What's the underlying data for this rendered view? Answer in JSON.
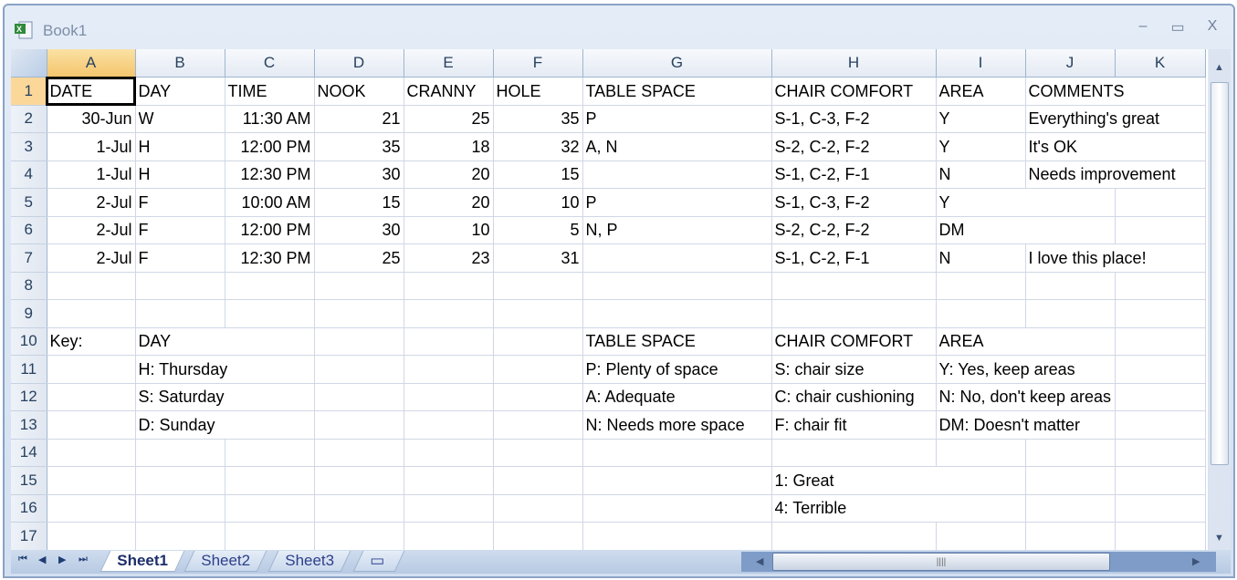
{
  "window": {
    "title": "Book1",
    "icon": "excel-workbook-icon",
    "minimize": "–",
    "maximize": "▭",
    "close": "X"
  },
  "columns": [
    "A",
    "B",
    "C",
    "D",
    "E",
    "F",
    "G",
    "H",
    "I",
    "J",
    "K"
  ],
  "selected_cell": "A1",
  "rows": [
    [
      "DATE",
      "DAY",
      "TIME",
      "NOOK",
      "CRANNY",
      "HOLE",
      "TABLE SPACE",
      "CHAIR COMFORT",
      "AREA",
      "COMMENTS",
      ""
    ],
    [
      "30-Jun",
      "W",
      "11:30 AM",
      "21",
      "25",
      "35",
      "P",
      "S-1, C-3, F-2",
      "Y",
      "Everything's great",
      ""
    ],
    [
      "1-Jul",
      "H",
      "12:00 PM",
      "35",
      "18",
      "32",
      "A, N",
      "S-2, C-2, F-2",
      "Y",
      "It's OK",
      ""
    ],
    [
      "1-Jul",
      "H",
      "12:30 PM",
      "30",
      "20",
      "15",
      "",
      "S-1, C-2, F-1",
      "N",
      "Needs improvement",
      ""
    ],
    [
      "2-Jul",
      "F",
      "10:00 AM",
      "15",
      "20",
      "10",
      "P",
      "S-1, C-3, F-2",
      "Y",
      "",
      ""
    ],
    [
      "2-Jul",
      "F",
      "12:00 PM",
      "30",
      "10",
      "5",
      "N, P",
      "S-2, C-2, F-2",
      "DM",
      "",
      ""
    ],
    [
      "2-Jul",
      "F",
      "12:30 PM",
      "25",
      "23",
      "31",
      "",
      "S-1, C-2, F-1",
      "N",
      "I love this place!",
      ""
    ],
    [
      "",
      "",
      "",
      "",
      "",
      "",
      "",
      "",
      "",
      "",
      ""
    ],
    [
      "",
      "",
      "",
      "",
      "",
      "",
      "",
      "",
      "",
      "",
      ""
    ],
    [
      "Key:",
      "DAY",
      "",
      "",
      "",
      "",
      "TABLE SPACE",
      "CHAIR COMFORT",
      "AREA",
      "",
      ""
    ],
    [
      "",
      "H: Thursday",
      "",
      "",
      "",
      "",
      "P: Plenty of space",
      "S: chair size",
      "Y: Yes, keep areas",
      "",
      ""
    ],
    [
      "",
      "S: Saturday",
      "",
      "",
      "",
      "",
      "A: Adequate",
      "C: chair cushioning",
      "N: No, don't keep areas",
      "",
      ""
    ],
    [
      "",
      "D: Sunday",
      "",
      "",
      "",
      "",
      "N: Needs more space",
      "F: chair fit",
      "DM: Doesn't matter",
      "",
      ""
    ],
    [
      "",
      "",
      "",
      "",
      "",
      "",
      "",
      "",
      "",
      "",
      ""
    ],
    [
      "",
      "",
      "",
      "",
      "",
      "",
      "",
      "1: Great",
      "",
      "",
      ""
    ],
    [
      "",
      "",
      "",
      "",
      "",
      "",
      "",
      "4: Terrible",
      "",
      "",
      ""
    ],
    [
      "",
      "",
      "",
      "",
      "",
      "",
      "",
      "",
      "",
      "",
      ""
    ]
  ],
  "sheets": {
    "tabs": [
      "Sheet1",
      "Sheet2",
      "Sheet3"
    ],
    "active": "Sheet1",
    "insert_icon": "insert-worksheet-icon"
  },
  "nav": {
    "first": "⏮",
    "prev": "◀",
    "next": "▶",
    "last": "⏭"
  }
}
